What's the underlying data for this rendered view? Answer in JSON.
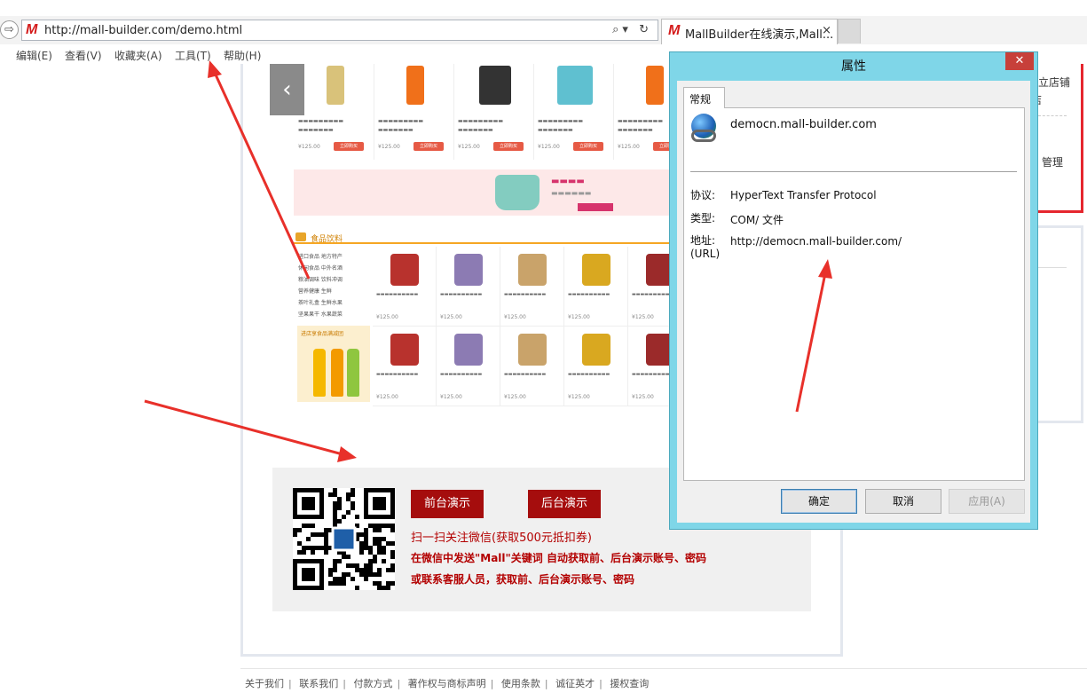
{
  "browser": {
    "url": "http://mall-builder.com/demo.html",
    "url_logo": "M",
    "url_tools": "⌕▾ ↻",
    "tab_title": "MallBuilder在线演示,Mall...",
    "tab_close": "×",
    "back_icon": "⇨",
    "menu": [
      "编辑(E)",
      "查看(V)",
      "收藏夹(A)",
      "工具(T)",
      "帮助(H)"
    ]
  },
  "page": {
    "carousel_prev": "‹",
    "category_title": "食品饮料",
    "side_links": [
      "进口食品 地方特产",
      "休闲食品 中外名酒",
      "粮油调味 饮料冲调",
      "营养健康 生鲜",
      "茶叶礼盒 生鲜水果",
      "坚果果干 水果蔬菜"
    ],
    "side_promo": "进店享食品满减团",
    "product_price": "¥125.00",
    "product_buy": "立即购买",
    "demo": {
      "front_button": "前台演示",
      "back_button": "后台演示",
      "line1": "扫一扫关注微信(获取500元抵扣券)",
      "line2": "在微信中发送\"Mall\"关键词 自动获取前、后台演示账号、密码",
      "line3": "或联系客服人员，获取前、后台演示账号、密码"
    },
    "footer": [
      "关于我们",
      "联系我们",
      "付款方式",
      "著作权与商标声明",
      "使用条款",
      "诚征英才",
      "援权查询"
    ],
    "right_partial": [
      "立店铺",
      "店",
      "管理"
    ]
  },
  "dialog": {
    "title": "属性",
    "close": "✕",
    "tab": "常规",
    "host": "democn.mall-builder.com",
    "protocol_label": "协议:",
    "protocol_value": "HyperText Transfer Protocol",
    "type_label": "类型:",
    "type_value": "COM/ 文件",
    "address_label": "地址:",
    "address_label2": "(URL)",
    "address_value": "http://democn.mall-builder.com/",
    "ok": "确定",
    "cancel": "取消",
    "apply": "应用(A)"
  },
  "colors": {
    "annotation_arrow": "#e8302a",
    "dialog_frame": "#7fd6e8",
    "demo_button": "#a50d0d"
  }
}
